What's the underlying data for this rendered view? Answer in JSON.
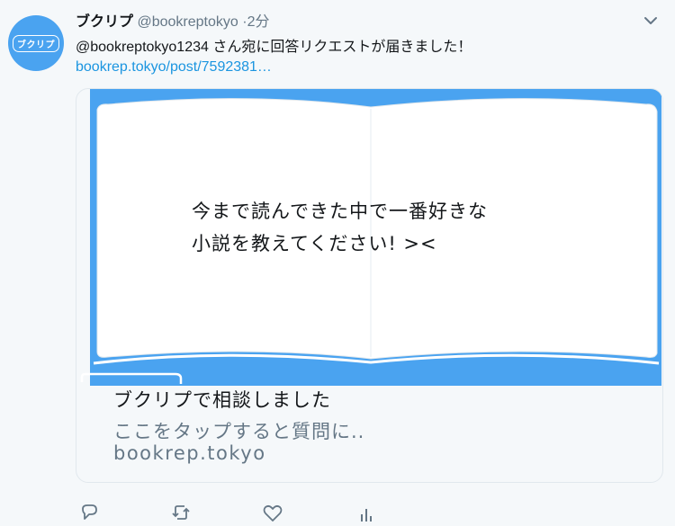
{
  "tweet": {
    "avatar": {
      "icon": "bookrep-logo-avatar",
      "label": "ブクリプ"
    },
    "name": "ブクリプ",
    "handle": "@bookreptokyo",
    "separator": "·",
    "time": "2分",
    "text": "@bookreptokyo1234 さん宛に回答リクエストが届きました！",
    "link": "bookrep.tokyo/post/7592381…"
  },
  "card": {
    "image": {
      "icon": "open-book-illustration",
      "lines": [
        "今まで読んできた中で一番好きな",
        "小説を教えてください! ><"
      ]
    },
    "title": "ブクリプで相談しました",
    "description": "ここをタップすると質問に..",
    "domain": "bookrep.tokyo"
  },
  "actions": [
    {
      "icon": "reply-icon"
    },
    {
      "icon": "retweet-icon"
    },
    {
      "icon": "like-icon"
    },
    {
      "icon": "analytics-icon"
    }
  ],
  "colors": {
    "accent": "#1b95e0",
    "card_bg": "#4aa3f0",
    "text_secondary": "#657786",
    "background": "#f5f8fa"
  }
}
